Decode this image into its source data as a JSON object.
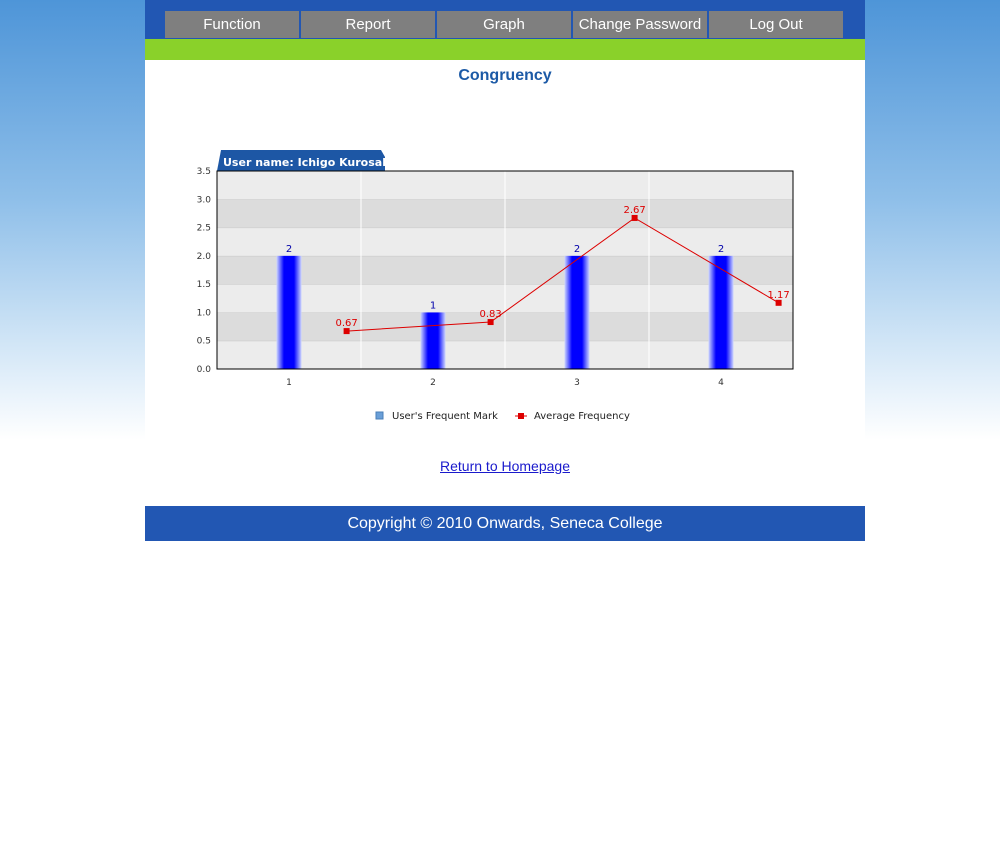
{
  "nav": {
    "items": [
      {
        "label": "Function"
      },
      {
        "label": "Report"
      },
      {
        "label": "Graph"
      },
      {
        "label": "Change Password"
      },
      {
        "label": "Log Out"
      }
    ]
  },
  "page": {
    "title": "Congruency",
    "return_link": "Return to Homepage"
  },
  "footer": {
    "copyright": "Copyright © 2010 Onwards, Seneca College"
  },
  "colors": {
    "header_blue": "#2257b3",
    "accent_green": "#8ad12a",
    "bar_blue": "#0000ff",
    "line_red": "#dd0000",
    "title_blue": "#1c5aa6"
  },
  "chart_data": {
    "type": "bar",
    "tab_label": "User name: Ichigo Kurosaki",
    "categories": [
      "1",
      "2",
      "3",
      "4"
    ],
    "ylim": [
      0,
      3.5
    ],
    "yticks": [
      "0.0",
      "0.5",
      "1.0",
      "1.5",
      "2.0",
      "2.5",
      "3.0",
      "3.5"
    ],
    "grid": true,
    "legend_position": "bottom",
    "series": [
      {
        "name": "User's Frequent Mark",
        "kind": "bar",
        "values": [
          2,
          1,
          2,
          2
        ],
        "labels": [
          "2",
          "1",
          "2",
          "2"
        ]
      },
      {
        "name": "Average Frequency",
        "kind": "line",
        "values": [
          0.67,
          0.83,
          2.67,
          1.17
        ],
        "labels": [
          "0.67",
          "0.83",
          "2.67",
          "1.17"
        ]
      }
    ]
  }
}
